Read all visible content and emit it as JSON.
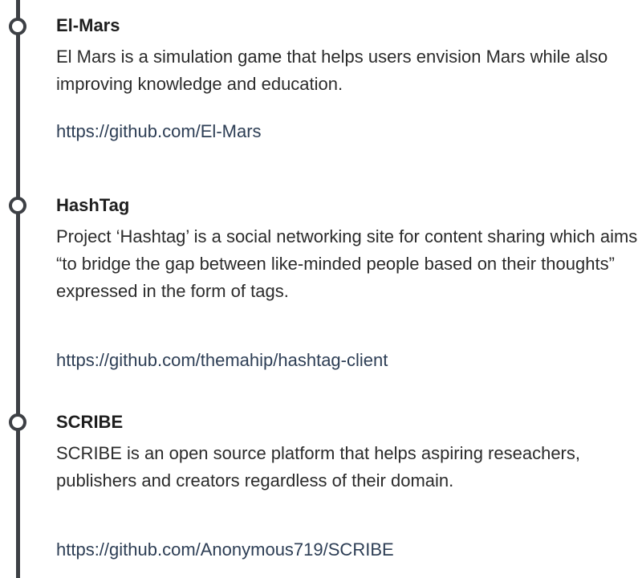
{
  "projects": [
    {
      "title": "El-Mars",
      "description": "El Mars is a simulation game that helps users envision Mars while also improving knowledge and education.",
      "link": "https://github.com/El-Mars"
    },
    {
      "title": "HashTag",
      "description": "Project ‘Hashtag’ is a social networking site for content sharing which aims “to bridge the gap between like-minded people based on their thoughts” expressed in the form of tags.",
      "link": "https://github.com/themahip/hashtag-client"
    },
    {
      "title": "SCRIBE",
      "description": "SCRIBE is an open source platform that helps aspiring reseachers, publishers and creators regardless of their domain.",
      "link": "https://github.com/Anonymous719/SCRIBE"
    }
  ],
  "colors": {
    "timeline": "#3d4045",
    "link": "#2d3e55",
    "text": "#2b2b2b"
  },
  "icons": {
    "marker": "timeline-circle-icon"
  }
}
